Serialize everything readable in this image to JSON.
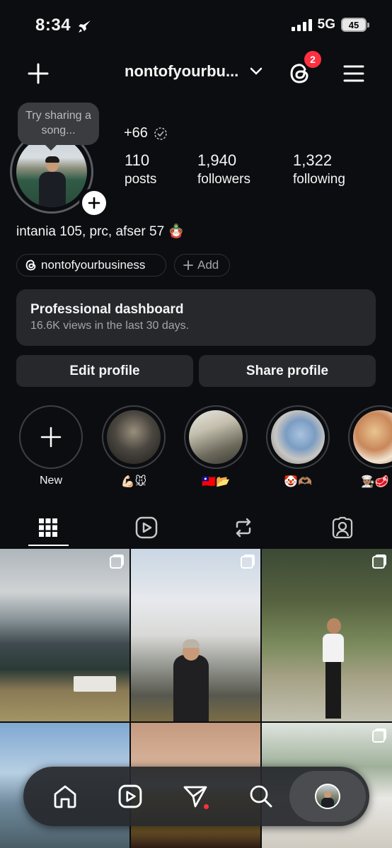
{
  "status_bar": {
    "time": "8:34",
    "network": "5G",
    "battery": "45"
  },
  "header": {
    "username": "nontofyourbu...",
    "threads_badge": "2"
  },
  "profile": {
    "song_prompt": "Try sharing a song...",
    "nickname": "+66",
    "stats": [
      {
        "value": "110",
        "label": "posts"
      },
      {
        "value": "1,940",
        "label": "followers"
      },
      {
        "value": "1,322",
        "label": "following"
      }
    ],
    "bio": "intania 105, prc, afser 57 🪆",
    "threads_chip": "nontofyourbusiness",
    "add_chip": "Add"
  },
  "dashboard": {
    "title": "Professional dashboard",
    "subtitle": "16.6K views in the last 30 days."
  },
  "actions": {
    "edit": "Edit profile",
    "share": "Share profile"
  },
  "highlights": [
    {
      "label": "New"
    },
    {
      "label": "💪🏻🐭"
    },
    {
      "label": "🇹🇼📂"
    },
    {
      "label": "🤡🫶🏽"
    },
    {
      "label": "👨🏽‍🍳🥩"
    }
  ],
  "tabs": [
    "grid-icon",
    "reels-icon",
    "reposts-icon",
    "tagged-icon"
  ],
  "nav": [
    "home-icon",
    "reels-icon",
    "send-icon",
    "search-icon",
    "profile-avatar"
  ],
  "colors": {
    "background": "#0c0d10",
    "surface": "#26282c",
    "badge": "#ff3040"
  }
}
